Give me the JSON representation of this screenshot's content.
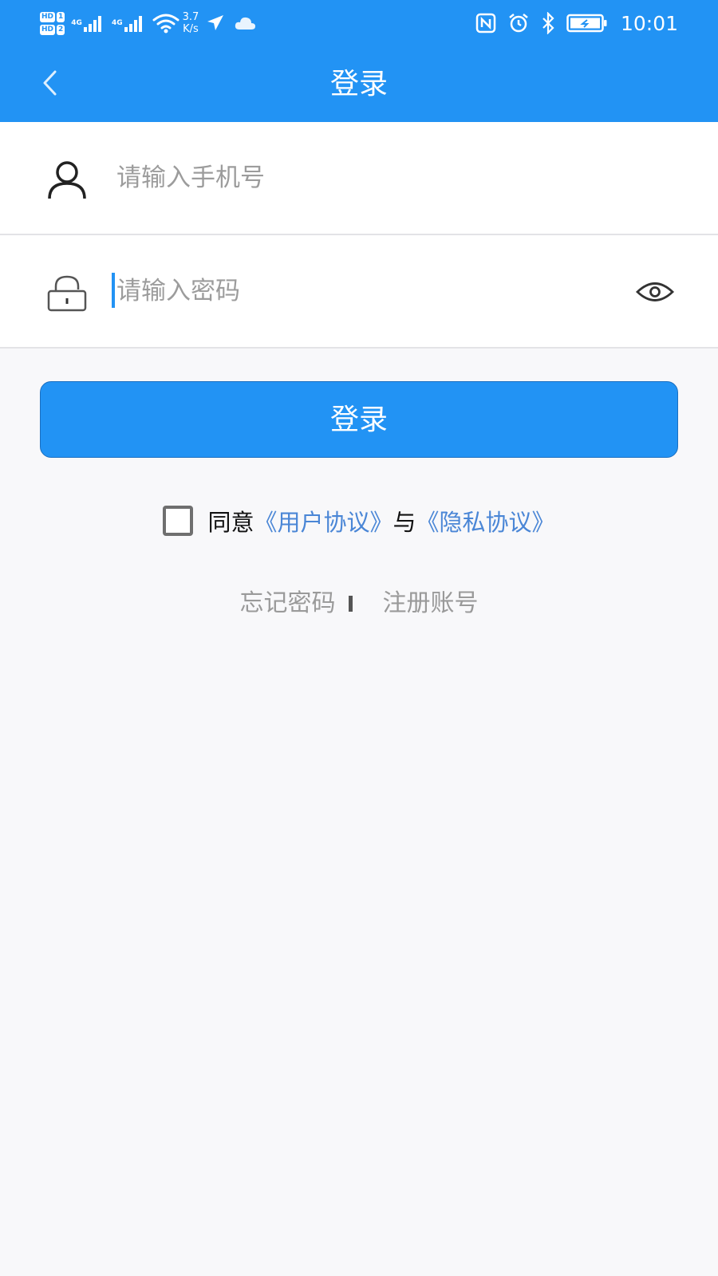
{
  "status_bar": {
    "hd1": "HD",
    "hd1_num": "1",
    "hd2": "HD",
    "hd2_num": "2",
    "net1": "4G",
    "net2": "4G",
    "speed_value": "3.7",
    "speed_unit": "K/s",
    "time": "10:01",
    "icons": [
      "signal-icon",
      "wifi-icon",
      "airplane-icon",
      "cloud-icon",
      "nfc-icon",
      "alarm-icon",
      "bluetooth-icon",
      "battery-icon"
    ]
  },
  "nav": {
    "title": "登录",
    "back_icon": "chevron-left-icon"
  },
  "form": {
    "phone": {
      "icon": "user-icon",
      "placeholder": "请输入手机号",
      "value": ""
    },
    "password": {
      "icon": "lock-icon",
      "placeholder": "请输入密码",
      "value": "",
      "toggle_icon": "eye-icon"
    },
    "login_button": "登录"
  },
  "agreement": {
    "checked": false,
    "prefix": "同意",
    "user_agreement": "《用户协议》",
    "conjunction": "与",
    "privacy_agreement": "《隐私协议》"
  },
  "links": {
    "forgot_password": "忘记密码",
    "register": "注册账号"
  },
  "colors": {
    "primary": "#2293f4",
    "link": "#4a86d6",
    "placeholder": "#9c9c9c",
    "background": "#f8f8fa"
  }
}
